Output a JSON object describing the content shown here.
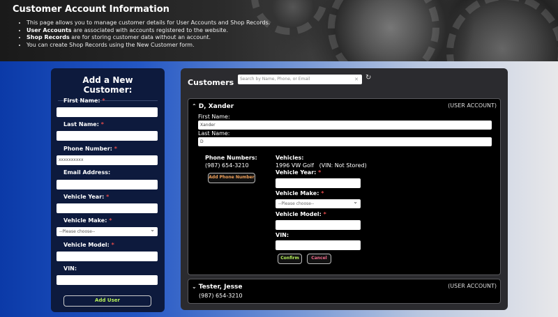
{
  "header": {
    "title": "Customer Account Information",
    "bullets": [
      {
        "bold": "",
        "text": "This page allows you to manage customer details for User Accounts and Shop Records."
      },
      {
        "bold": "User Accounts",
        "text": " are associated with accounts registered to the website."
      },
      {
        "bold": "Shop Records",
        "text": " are for storing customer data without an account."
      },
      {
        "bold": "",
        "text": "You can create Shop Records using the New Customer form."
      }
    ]
  },
  "new_customer": {
    "title": "Add a New Customer:",
    "first_name_label": "First Name:",
    "last_name_label": "Last Name:",
    "phone_label": "Phone Number:",
    "phone_placeholder": "xxxxxxxxxx",
    "email_label": "Email Address:",
    "vehicle_year_label": "Vehicle Year:",
    "vehicle_make_label": "Vehicle Make:",
    "vehicle_make_value": "--Please choose--",
    "vehicle_model_label": "Vehicle Model:",
    "vin_label": "VIN:",
    "add_button": "Add User",
    "required_mark": "*"
  },
  "customers": {
    "title": "Customers",
    "search_placeholder": "Search by Name, Phone, or Email",
    "search_clear": "✕",
    "refresh_icon": "↻",
    "list": [
      {
        "chevron": "⌃",
        "name": "D, Xander",
        "account_type": "(USER ACCOUNT)",
        "first_name_label": "First Name:",
        "first_name": "Xander",
        "last_name_label": "Last Name:",
        "last_name": "D",
        "phone_numbers_label": "Phone Numbers:",
        "phone": "(987) 654-3210",
        "add_phone_button": "Add Phone Number",
        "vehicles_label": "Vehicles:",
        "vehicle": "1996 VW Golf",
        "vin_status": "(VIN: Not Stored)",
        "vehicle_year_label": "Vehicle Year:",
        "vehicle_make_label": "Vehicle Make:",
        "vehicle_make_value": "--Please choose--",
        "vehicle_model_label": "Vehicle Model:",
        "vin_label": "VIN:",
        "confirm_button": "Confirm",
        "cancel_button": "Cancel"
      },
      {
        "chevron": "⌄",
        "name": "Tester, Jesse",
        "account_type": "(USER ACCOUNT)",
        "phone": "(987) 654-3210"
      }
    ]
  },
  "colors": {
    "required": "#e24a4a",
    "add_user_text": "#b6ef5a",
    "add_phone_text": "#f0a05a",
    "cancel_text": "#f06a8a"
  }
}
